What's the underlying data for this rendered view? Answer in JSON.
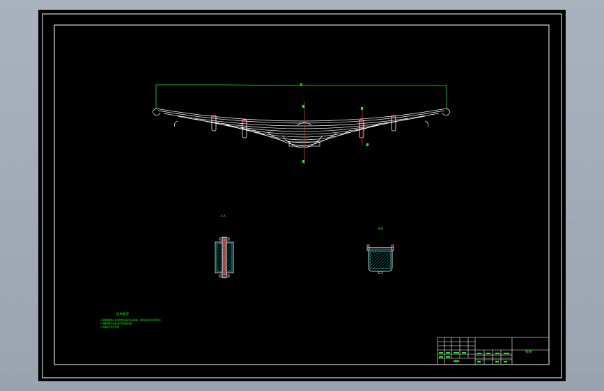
{
  "section_labels": {
    "aa": "A-A",
    "bb": "B-B"
  },
  "tech_title": "技术要求",
  "tech_lines": [
    "1.钢板弹簧各片在装配前应涂石墨润滑脂，装配后各片应紧密贴合",
    "2.钢板弹簧总成应进行预压缩处理",
    "3.表面进行喷丸处理"
  ],
  "title_block": {
    "drawing_name": "板簧"
  },
  "colors": {
    "background": "#000000",
    "frame": "#ffffff",
    "spring": "#ffffff",
    "dimension": "#00ff00",
    "centerline": "#ff0000",
    "hatch": "#00ffff",
    "outer": "#a3adb8"
  }
}
